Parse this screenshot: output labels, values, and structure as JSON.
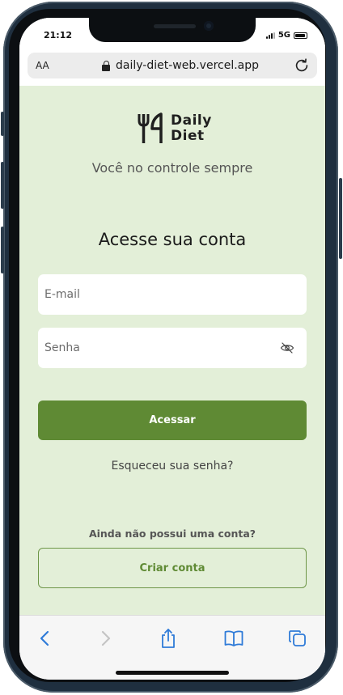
{
  "status_bar": {
    "time": "21:12",
    "network": "5G"
  },
  "browser": {
    "text_size_label": "AA",
    "url": "daily-diet-web.vercel.app"
  },
  "app": {
    "logo_line1": "Daily",
    "logo_line2": "Diet",
    "tagline": "Você no controle sempre",
    "heading": "Acesse sua conta",
    "email_placeholder": "E-mail",
    "password_placeholder": "Senha",
    "login_button": "Acessar",
    "forgot_link": "Esqueceu sua senha?",
    "no_account_text": "Ainda não possui uma conta?",
    "create_account_button": "Criar conta"
  },
  "colors": {
    "page_background": "#e3efd8",
    "primary": "#5f8a34",
    "toolbar_icon": "#2f7bd8"
  },
  "icons": {
    "lock": "lock-icon",
    "reload": "reload-icon",
    "password_toggle": "eye-off-icon",
    "back": "back-icon",
    "forward": "forward-icon",
    "share": "share-icon",
    "bookmarks": "bookmarks-icon",
    "tabs": "tabs-icon"
  }
}
